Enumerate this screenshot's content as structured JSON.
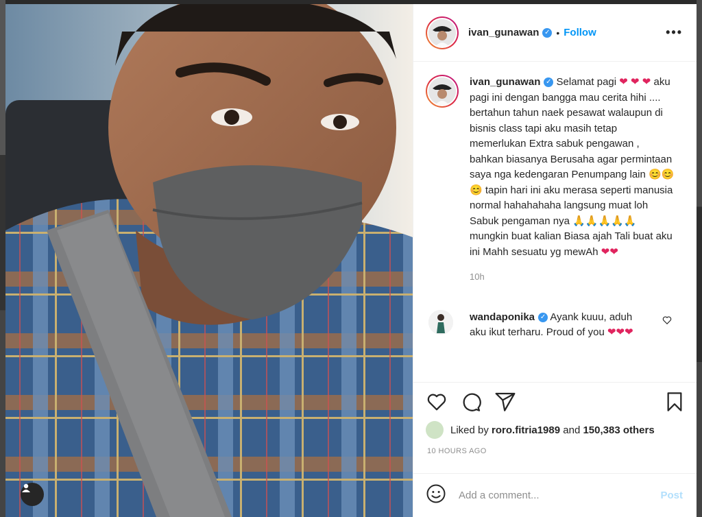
{
  "post": {
    "username": "ivan_gunawan",
    "verified_mark": "✓",
    "follow_label": "Follow",
    "separator": "•",
    "more_label": "•••"
  },
  "caption": {
    "username": "ivan_gunawan",
    "text_1": "Selamat pagi",
    "text_2": "aku pagi ini dengan bangga mau cerita hihi .... bertahun tahun naek pesawat walaupun di bisnis class tapi aku masih tetap memerlukan Extra sabuk pengawan , bahkan biasanya Berusaha agar permintaan saya nga kedengaran Penumpang lain",
    "text_3": "tapin hari ini aku merasa seperti manusia normal hahahahaha langsung muat loh Sabuk pengaman nya",
    "text_4": "mungkin buat kalian Biasa ajah Tali buat aku ini Mahh sesuatu yg mewAh",
    "heart": "❤",
    "smile": "😊",
    "pray": "🙏",
    "time": "10h"
  },
  "comment": {
    "username": "wandaponika",
    "text": "Ayank kuuu, aduh aku ikut terharu. Proud of you"
  },
  "likes": {
    "prefix": "Liked by",
    "user": "roro.fitria1989",
    "conj": "and",
    "others": "150,383 others"
  },
  "posted_ago": "10 HOURS AGO",
  "add_comment": {
    "placeholder": "Add a comment...",
    "post_label": "Post"
  },
  "colors": {
    "accent": "#0095f6",
    "heart": "#e0245e",
    "verified": "#3897f0"
  }
}
